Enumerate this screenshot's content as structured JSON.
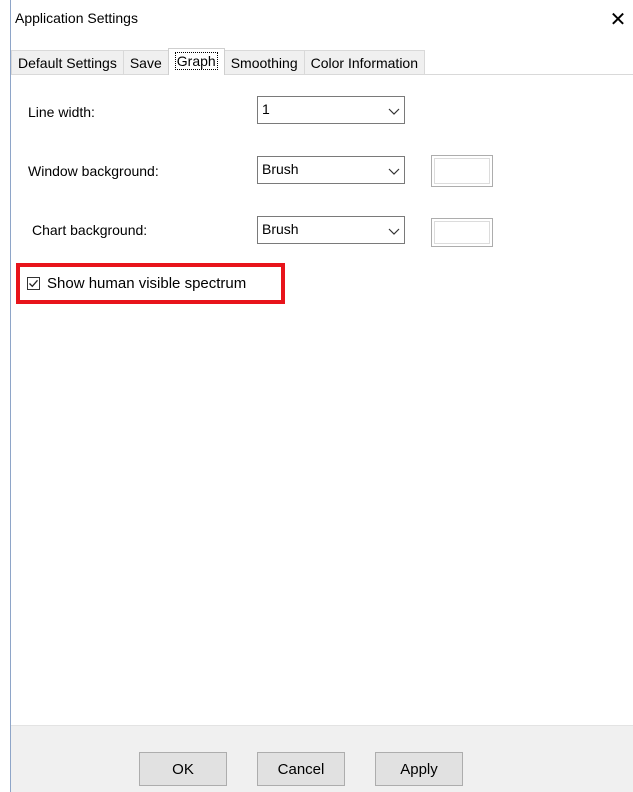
{
  "window": {
    "title": "Application Settings",
    "close_glyph": "✕"
  },
  "tabs": [
    {
      "label": "Default Settings",
      "active": false
    },
    {
      "label": "Save",
      "active": false
    },
    {
      "label": "Graph",
      "active": true
    },
    {
      "label": "Smoothing",
      "active": false
    },
    {
      "label": "Color Information",
      "active": false
    }
  ],
  "graph": {
    "line_width": {
      "label": "Line width:",
      "value": "1"
    },
    "window_background": {
      "label": "Window background:",
      "value": "Brush"
    },
    "chart_background": {
      "label": "Chart background:",
      "value": "Brush"
    },
    "show_spectrum": {
      "label": "Show human visible spectrum",
      "checked": true
    }
  },
  "buttons": {
    "ok": "OK",
    "cancel": "Cancel",
    "apply": "Apply"
  },
  "colors": {
    "highlight": "#e8141b",
    "footer_bg": "#f0f0f0"
  }
}
